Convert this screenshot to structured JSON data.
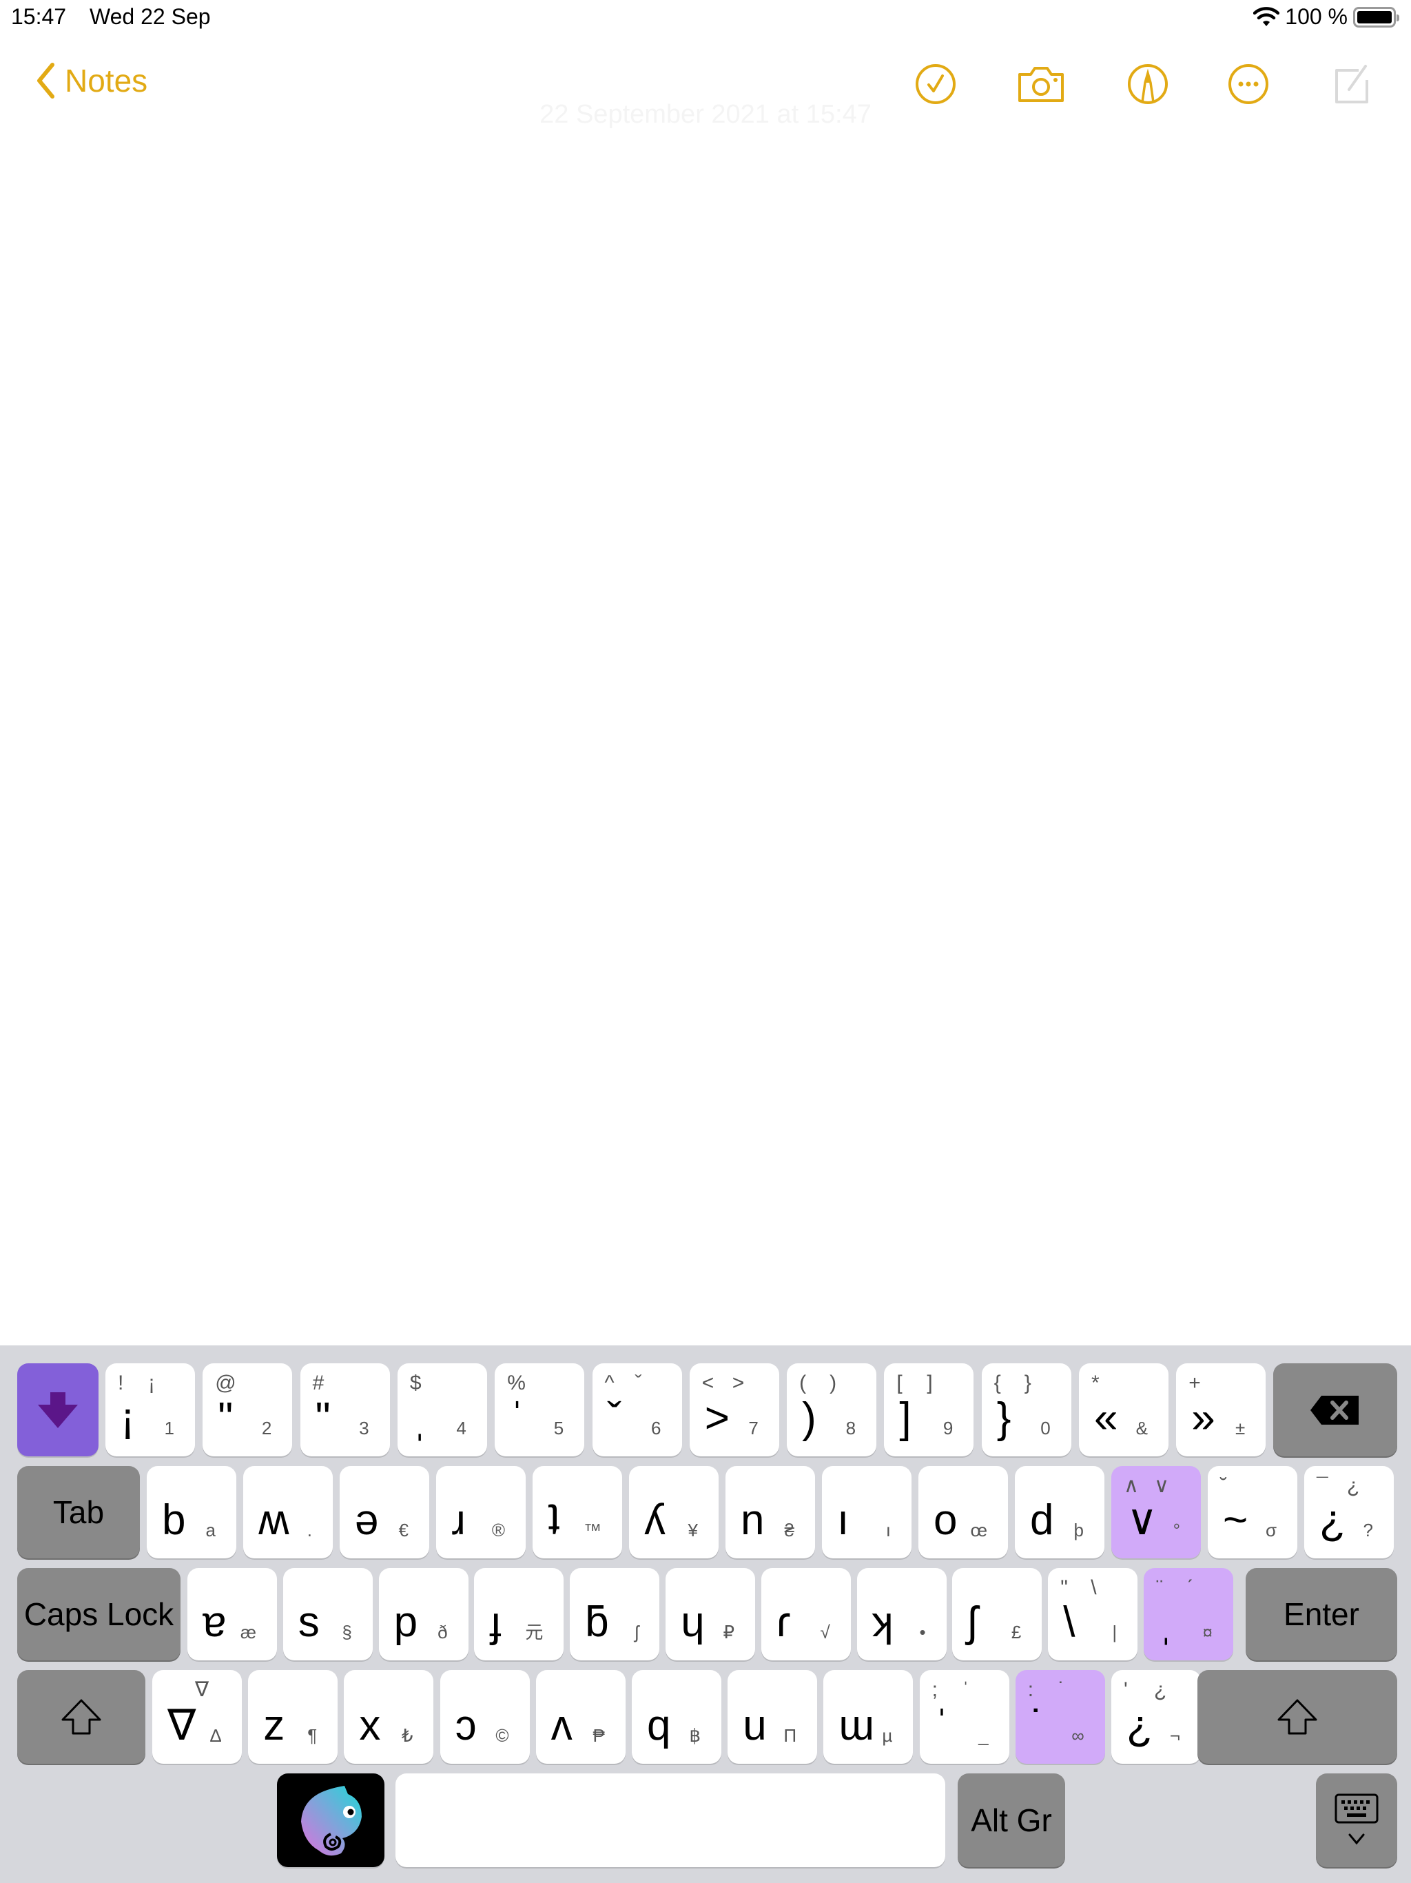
{
  "status_bar": {
    "time": "15:47",
    "date": "Wed 22 Sep",
    "battery": "100 %",
    "battery_level_percent": 100
  },
  "nav": {
    "back_label": "Notes",
    "icons": [
      "checklist-icon",
      "camera-icon",
      "markup-icon",
      "more-icon",
      "compose-icon"
    ],
    "accent_color": "#e2aa14",
    "timestamp": "22 September 2021 at 15:47"
  },
  "keyboard": {
    "row1": [
      {
        "main": "¡",
        "sub": "1",
        "tl": "!",
        "tr": "¡"
      },
      {
        "main": "ʺ",
        "sub": "2",
        "tl": "@",
        "tr": ""
      },
      {
        "main": "ʺ",
        "sub": "3",
        "tl": "#",
        "tr": ""
      },
      {
        "main": "ˌ",
        "sub": "4",
        "tl": "$",
        "tr": ""
      },
      {
        "main": "ˈ",
        "sub": "5",
        "tl": "%",
        "tr": ""
      },
      {
        "main": "ˇ",
        "sub": "6",
        "tl": "^",
        "tr": "ˇ"
      },
      {
        "main": ">",
        "sub": "7",
        "tl": "<",
        "tr": ">"
      },
      {
        "main": ")",
        "sub": "8",
        "tl": "(",
        "tr": ")"
      },
      {
        "main": "]",
        "sub": "9",
        "tl": "[",
        "tr": "]"
      },
      {
        "main": "}",
        "sub": "0",
        "tl": "{",
        "tr": "}"
      },
      {
        "main": "«",
        "sub": "&",
        "tl": "*",
        "tr": ""
      },
      {
        "main": "»",
        "sub": "±",
        "tl": "+",
        "tr": ""
      }
    ],
    "row2": [
      {
        "main": "b",
        "sub": "a",
        "tl": "",
        "tr": ""
      },
      {
        "main": "ʍ",
        "sub": ".",
        "tl": "",
        "tr": ""
      },
      {
        "main": "ə",
        "sub": "€",
        "tl": "",
        "tr": ""
      },
      {
        "main": "ɹ",
        "sub": "®",
        "tl": "",
        "tr": ""
      },
      {
        "main": "ʇ",
        "sub": "™",
        "tl": "",
        "tr": ""
      },
      {
        "main": "ʎ",
        "sub": "¥",
        "tl": "",
        "tr": ""
      },
      {
        "main": "n",
        "sub": "₴",
        "tl": "",
        "tr": ""
      },
      {
        "main": "ı",
        "sub": "ı",
        "tl": "",
        "tr": ""
      },
      {
        "main": "o",
        "sub": "œ",
        "tl": "",
        "tr": ""
      },
      {
        "main": "d",
        "sub": "þ",
        "tl": "",
        "tr": ""
      },
      {
        "main": "∨",
        "sub": "°",
        "tl": "∧",
        "tr": "∨",
        "highlight": true
      },
      {
        "main": "~",
        "sub": "σ",
        "tl": "˘",
        "tr": ""
      },
      {
        "main": "¿",
        "sub": "?",
        "tl": "¯",
        "tr": "¿"
      }
    ],
    "row3": [
      {
        "main": "ɐ",
        "sub": "æ"
      },
      {
        "main": "s",
        "sub": "§"
      },
      {
        "main": "p",
        "sub": "ð"
      },
      {
        "main": "ɟ",
        "sub": "元"
      },
      {
        "main": "ƃ",
        "sub": "ʃ"
      },
      {
        "main": "ɥ",
        "sub": "₽"
      },
      {
        "main": "ɾ",
        "sub": "√"
      },
      {
        "main": "ʞ",
        "sub": "•"
      },
      {
        "main": "ʃ",
        "sub": "£"
      },
      {
        "main": "\\",
        "sub": "|",
        "tl": "\"",
        "tr": "\\"
      },
      {
        "main": "ˌ",
        "sub": "¤",
        "tl": "¨",
        "tr": "ˊ",
        "highlight": true
      }
    ],
    "row4": [
      {
        "main": "∇",
        "sub": "∆",
        "tl": "",
        "tr": "∇"
      },
      {
        "main": "z",
        "sub": "¶"
      },
      {
        "main": "x",
        "sub": "₺"
      },
      {
        "main": "ɔ",
        "sub": "©"
      },
      {
        "main": "ʌ",
        "sub": "₱"
      },
      {
        "main": "q",
        "sub": "฿"
      },
      {
        "main": "u",
        "sub": "Π"
      },
      {
        "main": "ɯ",
        "sub": "µ"
      },
      {
        "main": "ˈ",
        "sub": "_",
        "tl": ";",
        "tr": "ˈ"
      },
      {
        "main": "˙",
        "sub": "∞",
        "tl": ":",
        "tr": "˙",
        "highlight": true
      },
      {
        "main": "¿",
        "sub": "¬",
        "tl": "'",
        "tr": "¿"
      }
    ],
    "special": {
      "tab": "Tab",
      "caps_lock": "Caps Lock",
      "enter": "Enter",
      "alt_gr": "Alt Gr",
      "space": ""
    },
    "colors": {
      "dismiss_key": "#8360d9",
      "highlight_key": "#d1aaf9",
      "modifier_key": "#898989",
      "background": "#d6d7dc"
    }
  }
}
